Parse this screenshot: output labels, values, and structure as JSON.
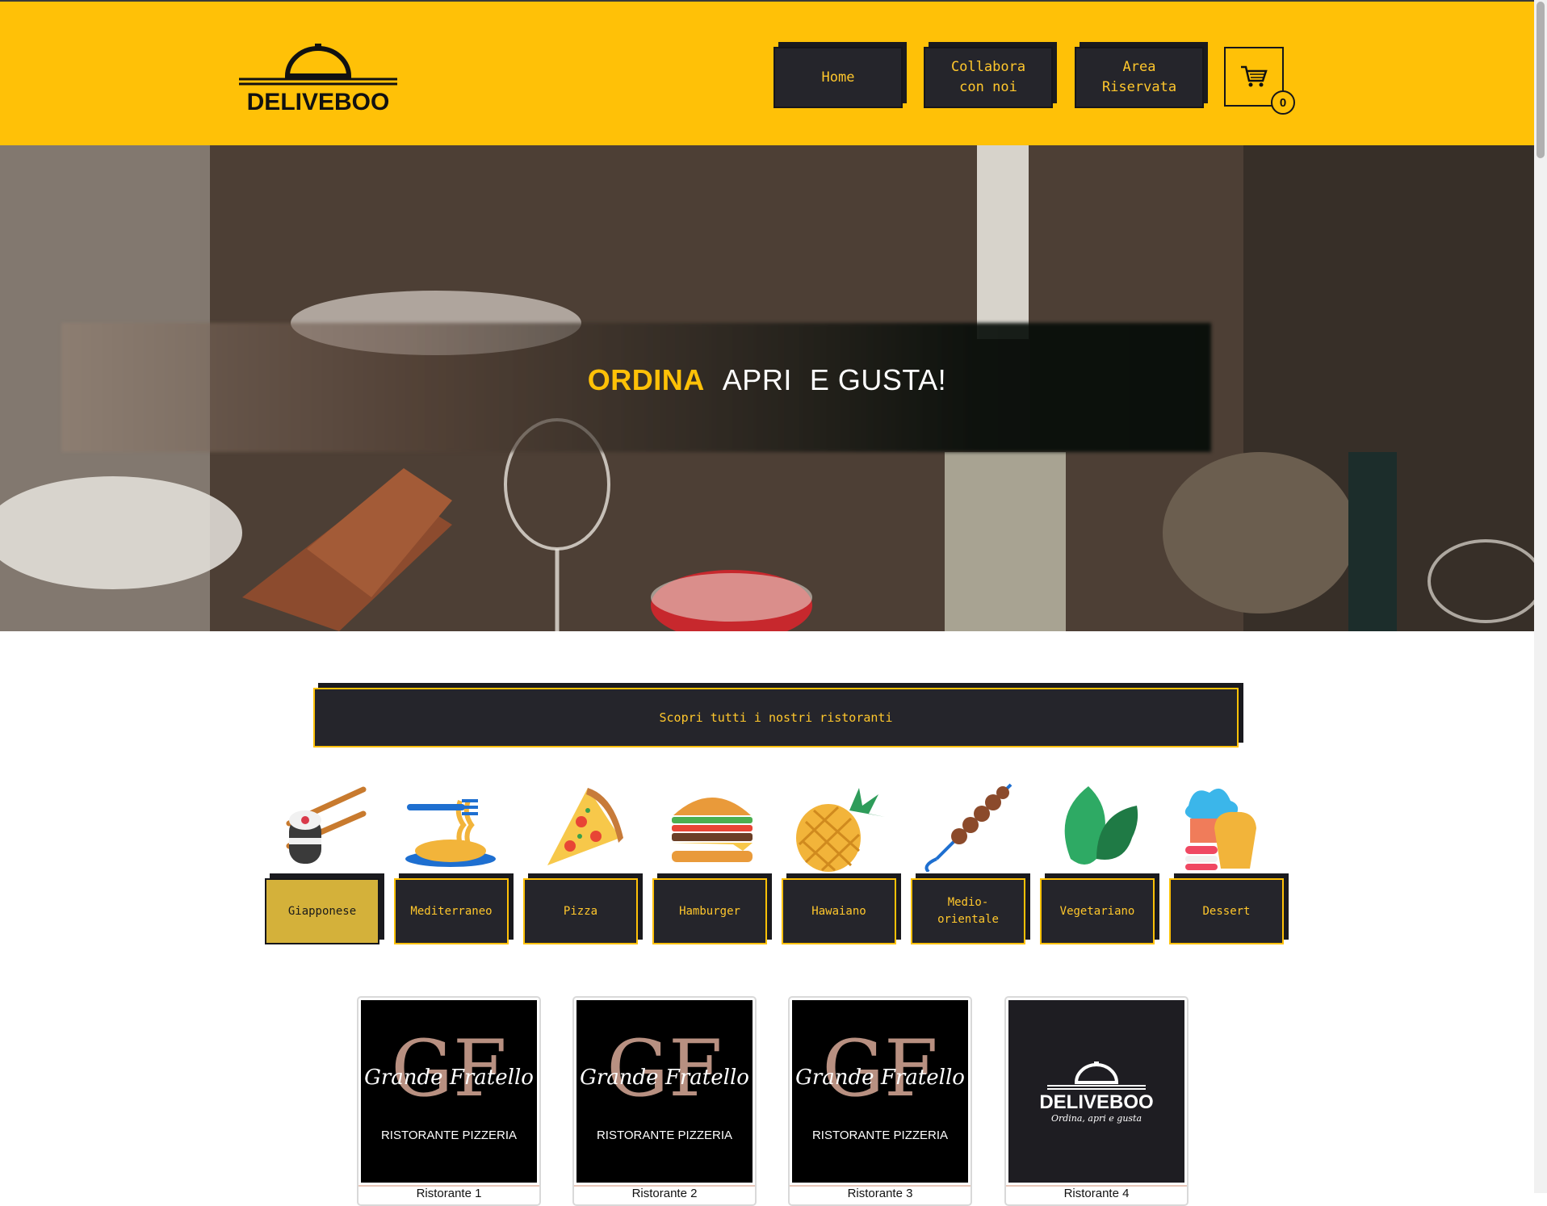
{
  "header": {
    "logo_text": "DELIVEBOO",
    "nav": [
      {
        "label": "Home"
      },
      {
        "label": "Collabora con noi"
      },
      {
        "label": "Area Riservata"
      }
    ],
    "cart_count": "0"
  },
  "hero": {
    "title_accent": "ORDINA",
    "title_word2": "APRI",
    "title_word3": "E GUSTA!"
  },
  "discover_button": "Scopri tutti i nostri ristoranti",
  "categories": [
    {
      "label": "Giapponese",
      "icon": "sushi-icon",
      "active": true
    },
    {
      "label": "Mediterraneo",
      "icon": "pasta-icon"
    },
    {
      "label": "Pizza",
      "icon": "pizza-icon"
    },
    {
      "label": "Hamburger",
      "icon": "hamburger-icon"
    },
    {
      "label": "Hawaiano",
      "icon": "pineapple-icon"
    },
    {
      "label": "Medio-orientale",
      "icon": "kebab-icon"
    },
    {
      "label": "Vegetariano",
      "icon": "leaf-icon"
    },
    {
      "label": "Dessert",
      "icon": "cupcake-icon"
    }
  ],
  "restaurants": [
    {
      "logo_title": "Grande Fratello",
      "logo_subtitle": "RISTORANTE PIZZERIA",
      "name": "Ristorante 1"
    },
    {
      "logo_title": "Grande Fratello",
      "logo_subtitle": "RISTORANTE PIZZERIA",
      "name": "Ristorante 2"
    },
    {
      "logo_title": "Grande Fratello",
      "logo_subtitle": "RISTORANTE PIZZERIA",
      "name": "Ristorante 3"
    },
    {
      "logo_title": "DELIVEBOO",
      "logo_subtitle": "Ordina, apri e gusta",
      "name": "Ristorante 4"
    }
  ],
  "colors": {
    "accent": "#ffc107",
    "dark": "#25252b",
    "active": "#d4b13a"
  }
}
